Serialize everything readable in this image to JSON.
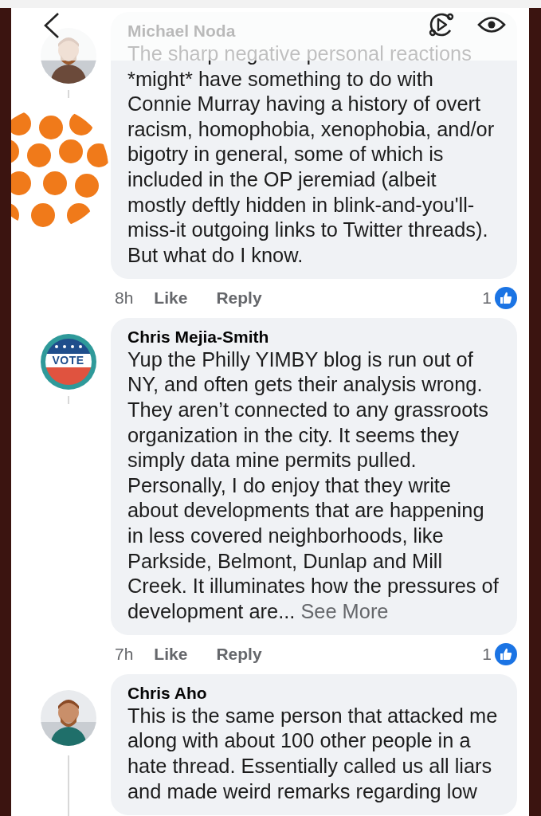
{
  "comments": [
    {
      "author": "Michael Noda",
      "text": "The sharp negative personal reactions *might* have something to do with Connie Murray having a history of overt racism, homophobia, xenophobia, and/or bigotry in general, some of which is included in the OP jeremiad (albeit mostly deftly hidden in blink-and-you'll-miss-it outgoing links to Twitter threads).  But what do I know.",
      "time": "8h",
      "like": "Like",
      "reply": "Reply",
      "reactions": "1"
    },
    {
      "author": "Chris Mejia-Smith",
      "avatar": {
        "kind": "badge",
        "text": "VOTE"
      },
      "text": "Yup the Philly YIMBY blog is run out of NY, and often gets their analysis wrong. They aren’t connected to any grassroots organization in the city. It seems they simply data mine permits pulled. Personally, I do enjoy that they write about developments that are happening in less covered neighborhoods, like Parkside, Belmont, Dunlap and Mill Creek. It illuminates how the pressures of development are...",
      "see_more": "See More",
      "time": "7h",
      "like": "Like",
      "reply": "Reply",
      "reactions": "1"
    },
    {
      "author": "Chris Aho",
      "text": "This is the same person that attacked me along with about 100 other people in a hate thread.  Essentially called us all liars and made weird remarks regarding low"
    }
  ]
}
